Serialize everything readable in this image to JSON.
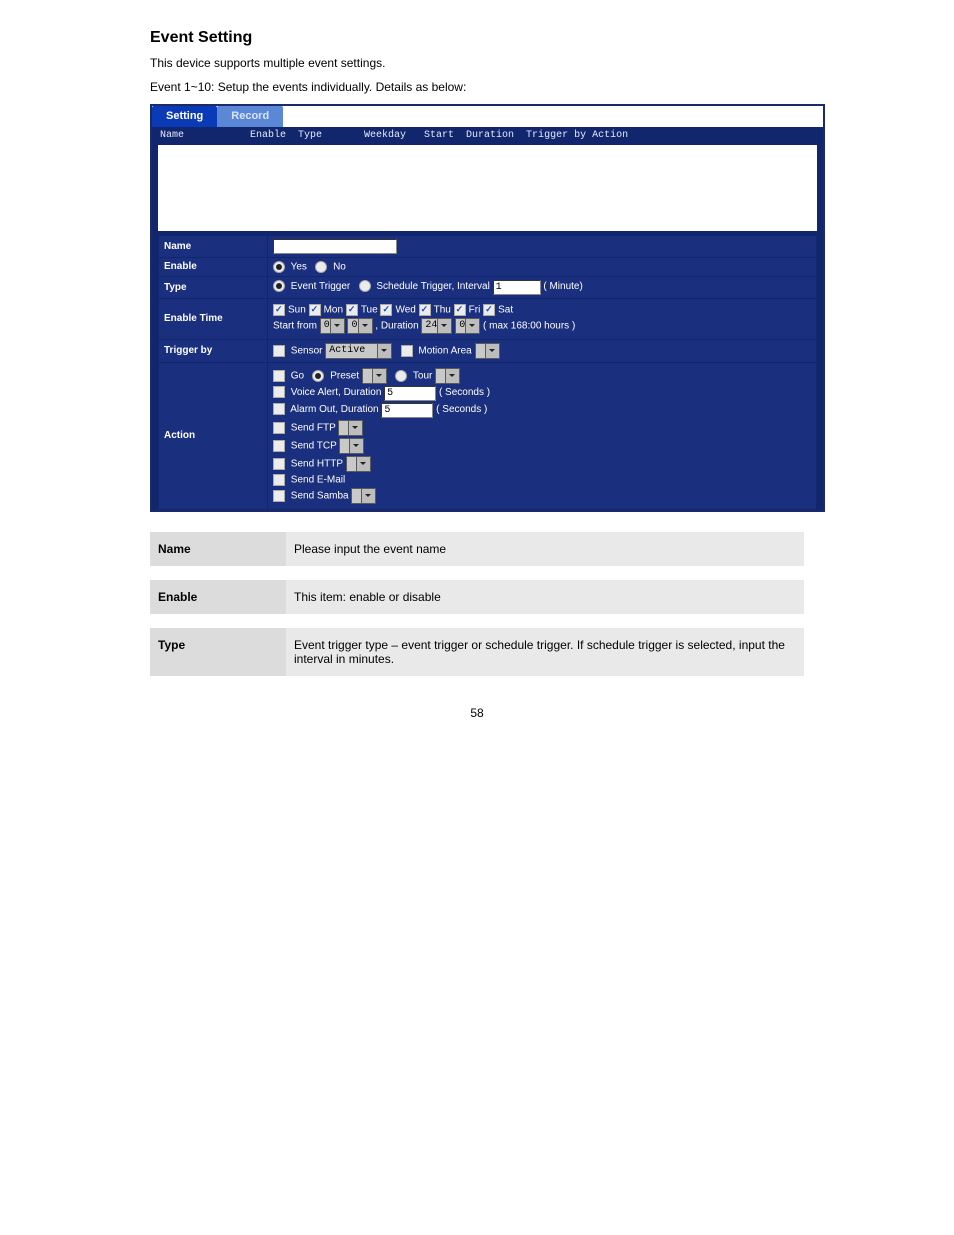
{
  "intro": {
    "heading": "Event Setting",
    "p1": "This device supports multiple event settings.",
    "p2": "Event 1~10: Setup the events individually. Details as below:"
  },
  "tabs": {
    "active": "Setting",
    "inactive": "Record"
  },
  "columns": "Name           Enable  Type       Weekday   Start  Duration  Trigger by Action",
  "form": {
    "name": {
      "label": "Name",
      "value": ""
    },
    "enable": {
      "label": "Enable",
      "yes": "Yes",
      "no": "No",
      "selected": "yes"
    },
    "type": {
      "label": "Type",
      "event": "Event Trigger",
      "schedule": "Schedule Trigger, Interval",
      "interval": "1",
      "unit": "( Minute)",
      "selected": "event"
    },
    "enable_time": {
      "label": "Enable Time",
      "days": [
        "Sun",
        "Mon",
        "Tue",
        "Wed",
        "Thu",
        "Fri",
        "Sat"
      ],
      "start_from": "Start from",
      "h1": "0",
      "m1": "0",
      "duration": ", Duration",
      "h2": "24",
      "m2": "0",
      "max": "( max 168:00 hours )"
    },
    "trigger": {
      "label": "Trigger by",
      "sensor_cb": "Sensor",
      "sensor_sel": "Active",
      "motion_cb": "Motion Area"
    },
    "action": {
      "label": "Action",
      "go": "Go",
      "preset": "Preset",
      "tour": "Tour",
      "voice": "Voice Alert, Duration",
      "voice_val": "5",
      "voice_unit": "( Seconds )",
      "alarm": "Alarm Out, Duration",
      "alarm_val": "5",
      "alarm_unit": "( Seconds )",
      "ftp": "Send FTP",
      "tcp": "Send TCP",
      "http": "Send HTTP",
      "email": "Send E-Mail",
      "samba": "Send Samba"
    }
  },
  "defs": {
    "name": {
      "k": "Name",
      "v": "Please input the event name"
    },
    "enable": {
      "k": "Enable",
      "v": "This item: enable or disable"
    },
    "type": {
      "k": "Type",
      "v": "Event trigger type – event trigger or schedule trigger. If schedule trigger is selected, input the interval in minutes."
    }
  },
  "pagenum": "58"
}
